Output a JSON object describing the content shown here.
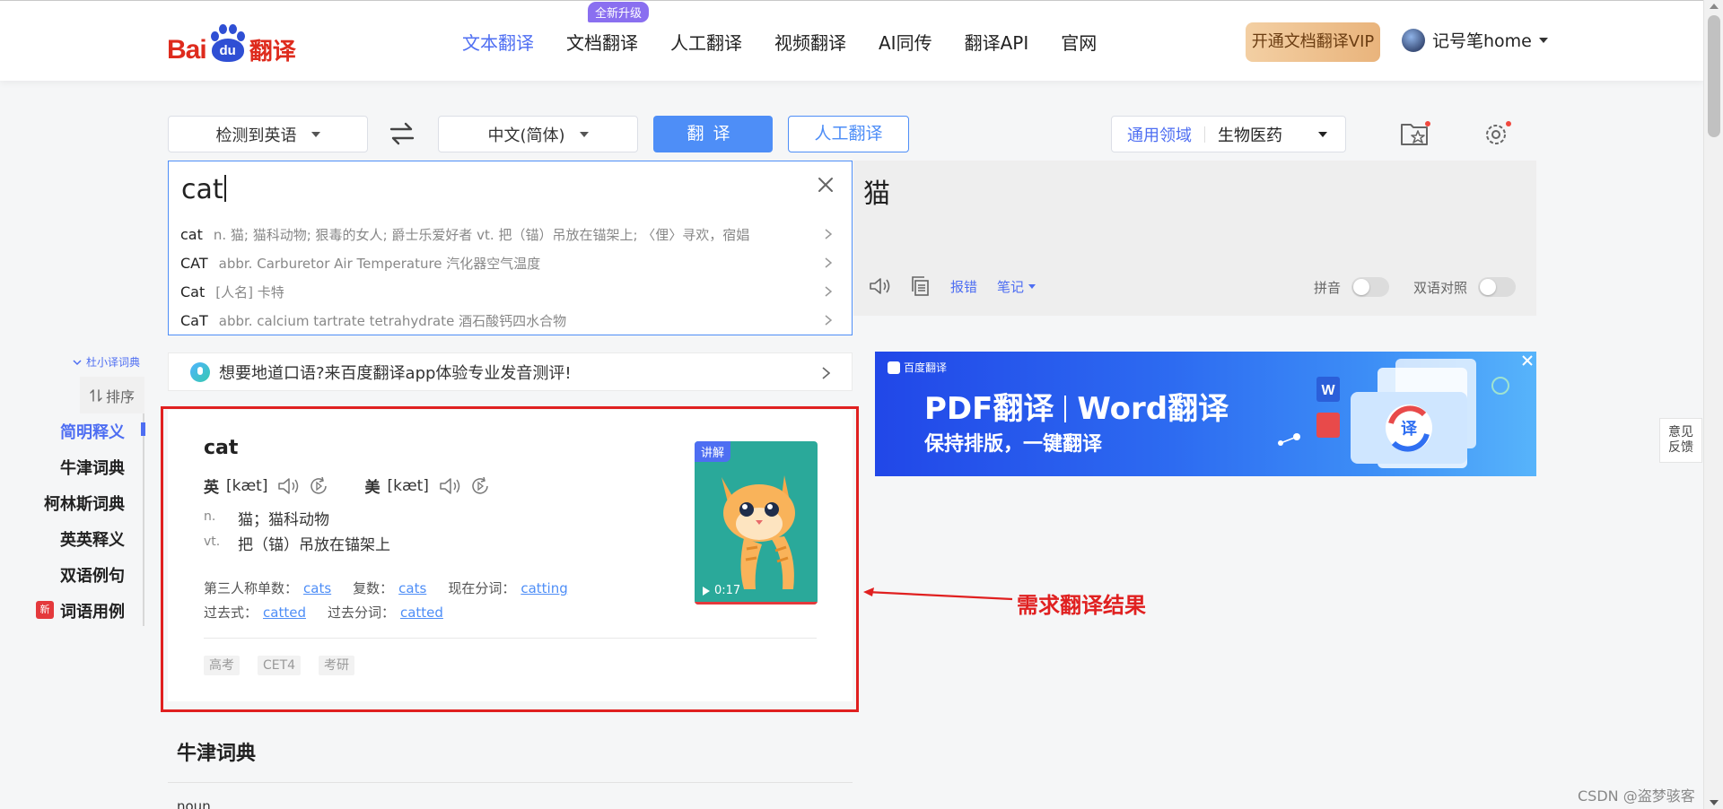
{
  "header": {
    "logo_bai": "Bai",
    "logo_du": "du",
    "logo_fanyi": "翻译",
    "nav": [
      {
        "label": "文本翻译",
        "active": true
      },
      {
        "label": "文档翻译",
        "badge": "全新升级"
      },
      {
        "label": "人工翻译"
      },
      {
        "label": "视频翻译"
      },
      {
        "label": "AI同传"
      },
      {
        "label": "翻译API"
      },
      {
        "label": "官网"
      }
    ],
    "vip_button": "开通文档翻译VIP",
    "username": "记号笔home"
  },
  "toolbar": {
    "source_lang": "检测到英语",
    "target_lang": "中文(简体)",
    "translate_button": "翻译",
    "human_button": "人工翻译",
    "domain_general": "通用领域",
    "domain_selected": "生物医药"
  },
  "input": {
    "value": "cat",
    "suggestions": [
      {
        "word": "cat",
        "meaning": "n. 猫; 猫科动物; 狠毒的女人; 爵士乐爱好者 vt. 把（锚）吊放在锚架上; 〈俚〉寻欢，宿娼"
      },
      {
        "word": "CAT",
        "meaning": "abbr. Carburetor Air Temperature 汽化器空气温度"
      },
      {
        "word": "Cat",
        "meaning": "[人名] 卡特"
      },
      {
        "word": "CaT",
        "meaning": "abbr. calcium tartrate tetrahydrate 酒石酸钙四水合物"
      }
    ]
  },
  "output": {
    "value": "猫",
    "report_error": "报错",
    "notes": "笔记",
    "pinyin_label": "拼音",
    "bilingual_label": "双语对照"
  },
  "sidebar": {
    "dict_tag": "杜小译词典",
    "sort_label": "排序",
    "new_badge": "新",
    "items": [
      {
        "label": "简明释义",
        "active": true
      },
      {
        "label": "牛津词典"
      },
      {
        "label": "柯林斯词典"
      },
      {
        "label": "英英释义"
      },
      {
        "label": "双语例句"
      },
      {
        "label": "词语用例"
      }
    ]
  },
  "promo": {
    "text": "想要地道口语?来百度翻译app体验专业发音测评!"
  },
  "ad": {
    "brand": "百度翻译",
    "title_left": "PDF翻译",
    "title_right": "Word翻译",
    "subtitle": "保持排版，一键翻译",
    "art_char": "译",
    "art_w": "W"
  },
  "dict_card": {
    "word": "cat",
    "uk_label": "英",
    "uk_phonetic": "[kæt]",
    "us_label": "美",
    "us_phonetic": "[kæt]",
    "definitions": [
      {
        "pos": "n.",
        "meaning": "猫；猫科动物"
      },
      {
        "pos": "vt.",
        "meaning": "把（锚）吊放在锚架上"
      }
    ],
    "forms_row1": [
      {
        "label": "第三人称单数：",
        "value": "cats"
      },
      {
        "label": "复数：",
        "value": "cats"
      },
      {
        "label": "现在分词：",
        "value": "catting"
      }
    ],
    "forms_row2": [
      {
        "label": "过去式：",
        "value": "catted"
      },
      {
        "label": "过去分词：",
        "value": "catted"
      }
    ],
    "tags": [
      "高考",
      "CET4",
      "考研"
    ],
    "video_tag": "讲解",
    "video_time": "0:17"
  },
  "annotation": {
    "text": "需求翻译结果"
  },
  "oxford": {
    "title": "牛津词典",
    "next": "noun"
  },
  "feedback": {
    "line1": "意见",
    "line2": "反馈"
  },
  "watermark": "CSDN @盗梦骇客",
  "colors": {
    "accent": "#4e6ef2",
    "button_blue": "#4e8ef7",
    "annotation_red": "#e02020",
    "brand_red": "#de2b1d"
  }
}
